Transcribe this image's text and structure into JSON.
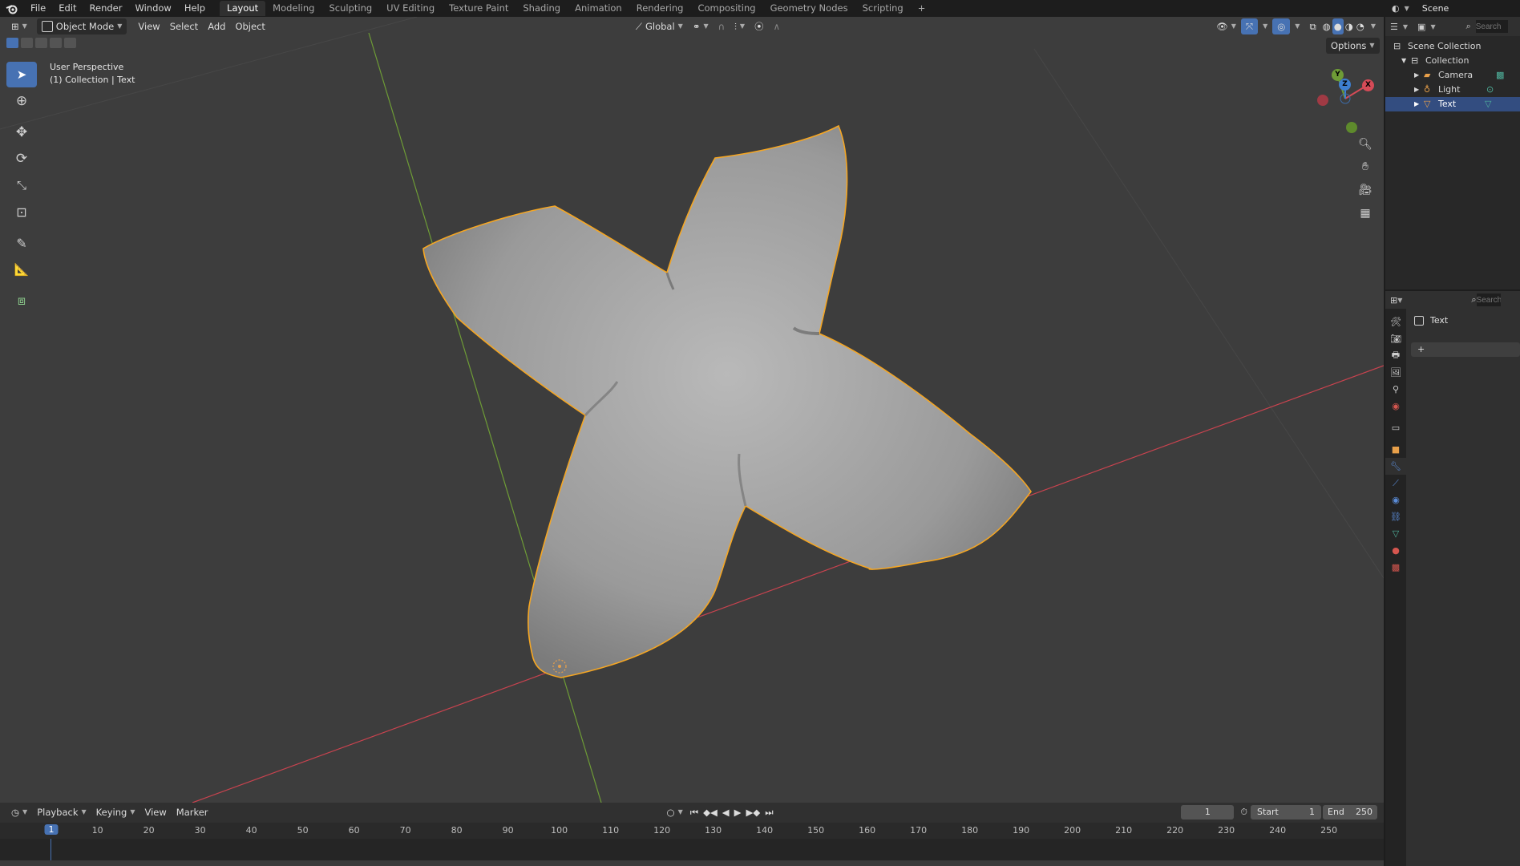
{
  "topbar": {
    "menus": [
      "File",
      "Edit",
      "Render",
      "Window",
      "Help"
    ],
    "workspaces": [
      "Layout",
      "Modeling",
      "Sculpting",
      "UV Editing",
      "Texture Paint",
      "Shading",
      "Animation",
      "Rendering",
      "Compositing",
      "Geometry Nodes",
      "Scripting"
    ],
    "add_tab": "+",
    "scene": "Scene"
  },
  "viewport": {
    "mode": "Object Mode",
    "menus": [
      "View",
      "Select",
      "Add",
      "Object"
    ],
    "transform_orientation": "Global",
    "options_label": "Options",
    "overlay_line1": "User Perspective",
    "overlay_line2": "(1) Collection | Text",
    "gizmo_axes": {
      "x": "X",
      "y": "Y",
      "z": "Z"
    }
  },
  "outliner": {
    "search_placeholder": "Search",
    "rows": [
      {
        "label": "Scene Collection",
        "icon": "scene-collection-icon"
      },
      {
        "label": "Collection",
        "icon": "collection-icon"
      },
      {
        "label": "Camera",
        "icon": "camera-icon"
      },
      {
        "label": "Light",
        "icon": "light-icon"
      },
      {
        "label": "Text",
        "icon": "text-object-icon",
        "selected": true
      }
    ]
  },
  "properties": {
    "search_placeholder": "Search",
    "object_name": "Text",
    "add_modifier": "+"
  },
  "timeline": {
    "menus": [
      "Playback",
      "Keying",
      "View",
      "Marker"
    ],
    "current_frame": "1",
    "start_label": "Start",
    "start_value": "1",
    "end_label": "End",
    "end_value": "250",
    "ticks": [
      "1",
      "10",
      "20",
      "30",
      "40",
      "50",
      "60",
      "70",
      "80",
      "90",
      "100",
      "110",
      "120",
      "130",
      "140",
      "150",
      "160",
      "170",
      "180",
      "190",
      "200",
      "210",
      "220",
      "230",
      "240",
      "250"
    ]
  },
  "colors": {
    "viewport_bg": "#3d3d3d",
    "selection_outline": "#f5a623",
    "accent_blue": "#4772b3",
    "x_axis": "#d54b57",
    "y_axis": "#6e9c36"
  }
}
